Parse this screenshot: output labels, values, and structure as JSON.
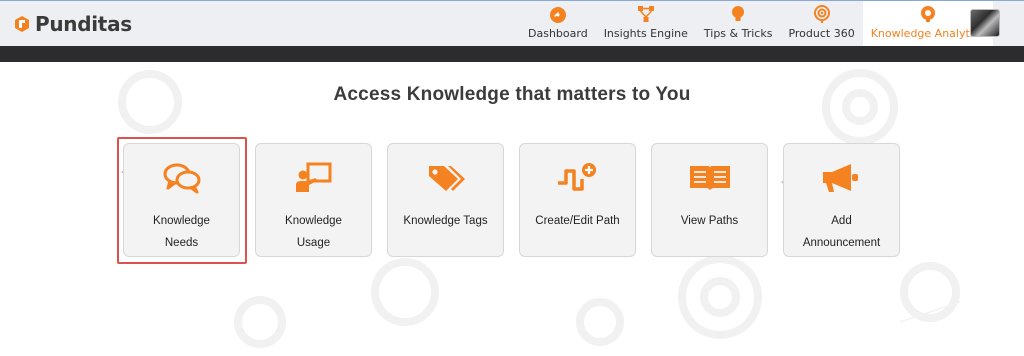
{
  "brand": {
    "name": "Punditas",
    "accent": "#f58220"
  },
  "nav": {
    "items": [
      {
        "label": "Dashboard",
        "icon": "dashboard-gauge-icon"
      },
      {
        "label": "Insights Engine",
        "icon": "network-nodes-icon"
      },
      {
        "label": "Tips & Tricks",
        "icon": "lightbulb-icon"
      },
      {
        "label": "Product 360",
        "icon": "radar-target-icon"
      },
      {
        "label": "Knowledge Analytics",
        "icon": "gear-bulb-icon",
        "active": true
      }
    ]
  },
  "main": {
    "heading": "Access Knowledge that matters to You",
    "tiles": [
      {
        "line1": "Knowledge",
        "line2": "Needs",
        "icon": "chat-bubbles-icon",
        "selected": true
      },
      {
        "line1": "Knowledge",
        "line2": "Usage",
        "icon": "presenter-board-icon"
      },
      {
        "line1": "Knowledge Tags",
        "line2": "",
        "icon": "tags-icon"
      },
      {
        "line1": "Create/Edit Path",
        "line2": "",
        "icon": "path-add-icon"
      },
      {
        "line1": "View Paths",
        "line2": "",
        "icon": "open-book-icon"
      },
      {
        "line1": "Add",
        "line2": "Announcement",
        "icon": "megaphone-icon"
      }
    ]
  }
}
